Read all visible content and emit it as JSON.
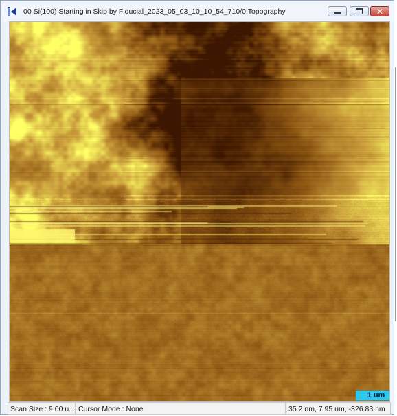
{
  "window": {
    "title": "00 Si(100) Starting in Skip by Fiducial_2023_05_03_10_10_54_710/0 Topography",
    "icons": {
      "app": "afm-scan-icon",
      "minimize": "minimize-icon",
      "maximize": "maximize-icon",
      "close": "close-icon"
    }
  },
  "image": {
    "type": "AFM topography heightmap",
    "palette": [
      "#3c1600",
      "#8a5412",
      "#c89a3a",
      "#ffff66"
    ],
    "scale_bar_label": "1 um",
    "scale_bar_color": "#2ec8ee"
  },
  "status": {
    "scan_size": "Scan Size : 9.00 u...",
    "cursor_mode": "Cursor Mode : None",
    "position": "35.2 nm, 7.95 um, -326.83 nm"
  }
}
